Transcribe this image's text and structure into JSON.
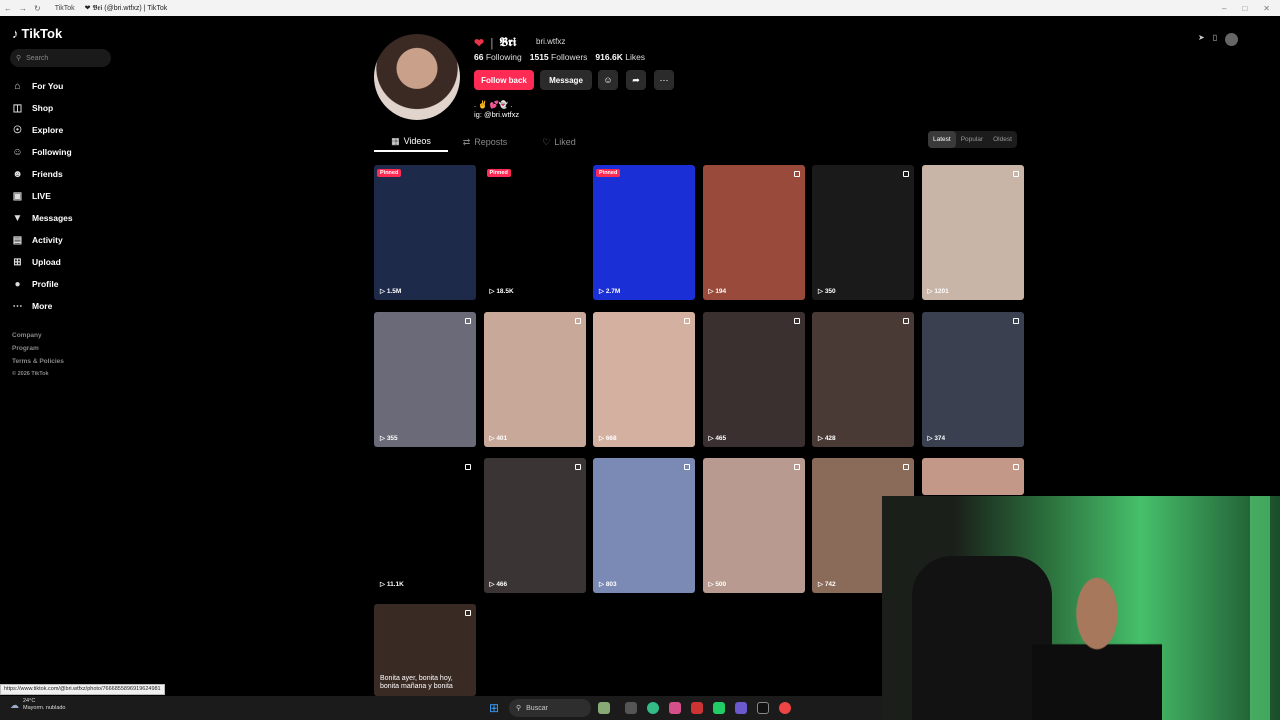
{
  "browser": {
    "tab1": "TikTok",
    "tab2": "❤ 𝕭𝖗𝖎 (@bri.wtfxz) | TikTok"
  },
  "sidebar": {
    "logo": "TikTok",
    "search_placeholder": "Search",
    "items": [
      {
        "label": "For You",
        "icon": "home-icon"
      },
      {
        "label": "Shop",
        "icon": "shop-icon"
      },
      {
        "label": "Explore",
        "icon": "compass-icon"
      },
      {
        "label": "Following",
        "icon": "following-icon"
      },
      {
        "label": "Friends",
        "icon": "friends-icon"
      },
      {
        "label": "LIVE",
        "icon": "live-icon"
      },
      {
        "label": "Messages",
        "icon": "messages-icon"
      },
      {
        "label": "Activity",
        "icon": "activity-icon"
      },
      {
        "label": "Upload",
        "icon": "upload-icon"
      },
      {
        "label": "Profile",
        "icon": "profile-icon"
      },
      {
        "label": "More",
        "icon": "more-icon"
      }
    ],
    "footer": [
      "Company",
      "Program",
      "Terms & Policies",
      "© 2026 TikTok"
    ]
  },
  "profile": {
    "name": "𝕭𝖗𝖎",
    "handle": "bri.wtfxz",
    "following_count": "66",
    "following_label": "Following",
    "followers_count": "1515",
    "followers_label": "Followers",
    "likes_count": "916.6K",
    "likes_label": "Likes",
    "follow_back_label": "Follow back",
    "message_label": "Message",
    "bio_line1": ". ✌ 💕👻 .",
    "bio_line2": "ig: @bri.wtfxz"
  },
  "tabs": {
    "videos": "Videos",
    "reposts": "Reposts",
    "liked": "Liked"
  },
  "sort": {
    "latest": "Latest",
    "popular": "Popular",
    "oldest": "Oldest"
  },
  "pinned_label": "Pinned",
  "videos": [
    {
      "views": "1.5M",
      "pinned": true,
      "color": "#1d2a4a"
    },
    {
      "views": "18.5K",
      "pinned": true,
      "color": "#000000"
    },
    {
      "views": "2.7M",
      "pinned": true,
      "color": "#1a2fd6"
    },
    {
      "views": "194",
      "pinned": false,
      "color": "#9a4a3a"
    },
    {
      "views": "350",
      "pinned": false,
      "color": "#1a1a1a"
    },
    {
      "views": "1201",
      "pinned": false,
      "color": "#c9b4a8"
    },
    {
      "views": "355",
      "pinned": false,
      "color": "#6a6a78"
    },
    {
      "views": "401",
      "pinned": false,
      "color": "#c8a898"
    },
    {
      "views": "668",
      "pinned": false,
      "color": "#d4b0a0"
    },
    {
      "views": "465",
      "pinned": false,
      "color": "#3a3030"
    },
    {
      "views": "428",
      "pinned": false,
      "color": "#4a3a36"
    },
    {
      "views": "374",
      "pinned": false,
      "color": "#3a4050"
    },
    {
      "views": "11.1K",
      "pinned": false,
      "color": "#000000"
    },
    {
      "views": "466",
      "pinned": false,
      "color": "#3a3434"
    },
    {
      "views": "803",
      "pinned": false,
      "color": "#7a8ab4"
    },
    {
      "views": "500",
      "pinned": false,
      "color": "#b89a90"
    },
    {
      "views": "742",
      "pinned": false,
      "color": "#8a6a58"
    },
    {
      "views": "",
      "pinned": false,
      "color": "#c49888"
    }
  ],
  "last_video_caption": "Bonita ayer, bonita hoy, bonita mañana y bonita",
  "status_url": "https://www.tiktok.com/@bri.wtfxz/photo/7666855896919624981",
  "taskbar": {
    "temp": "24°C",
    "weather": "Mayorm. nublado",
    "search": "Buscar"
  }
}
